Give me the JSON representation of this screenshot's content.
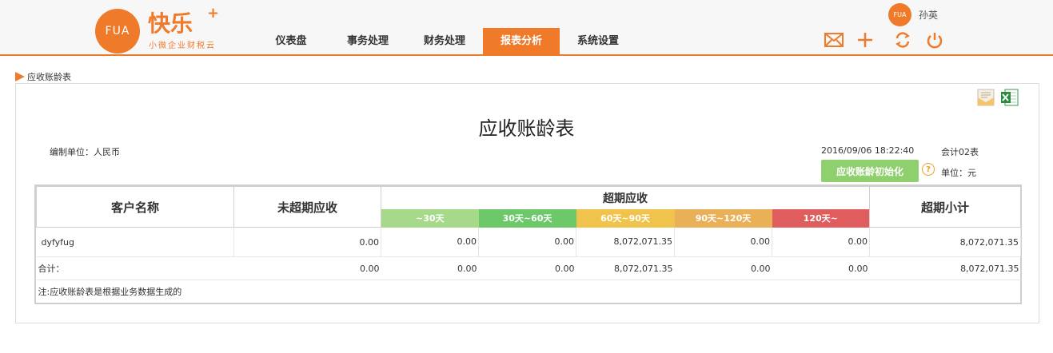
{
  "header": {
    "logo_mark": "FUA",
    "logo_name": "快乐",
    "logo_plus": "+",
    "logo_tagline": "小微企业财税云",
    "nav": [
      {
        "label": "仪表盘",
        "active": false
      },
      {
        "label": "事务处理",
        "active": false
      },
      {
        "label": "财务处理",
        "active": false
      },
      {
        "label": "报表分析",
        "active": true
      },
      {
        "label": "系统设置",
        "active": false
      }
    ],
    "user": {
      "avatar_text": "FUA",
      "name": "孙英"
    },
    "tools": [
      "mail-icon",
      "plus-icon",
      "refresh-icon",
      "power-icon"
    ],
    "accent": "#ef7a2a"
  },
  "breadcrumb": {
    "label": "应收账龄表"
  },
  "report": {
    "title": "应收账龄表",
    "unit_label": "编制单位：人民币",
    "datetime": "2016/09/06 18:22:40",
    "ledger": "会计02表",
    "init_button": "应收账龄初始化",
    "money_unit": "单位：元",
    "export_icons": [
      "email-icon",
      "excel-icon"
    ]
  },
  "table": {
    "headers": {
      "customer": "客户名称",
      "not_overdue": "未超期应收",
      "overdue": "超期应收",
      "subtotal": "超期小计"
    },
    "buckets": [
      {
        "label": "~30天",
        "color": "#a6d98a"
      },
      {
        "label": "30天~60天",
        "color": "#6dc86a"
      },
      {
        "label": "60天~90天",
        "color": "#f0c44c"
      },
      {
        "label": "90天~120天",
        "color": "#eab058"
      },
      {
        "label": "120天~",
        "color": "#e05d5d"
      }
    ],
    "rows": [
      {
        "customer": "dyfyfug",
        "not_overdue": "0.00",
        "buckets": [
          "0.00",
          "0.00",
          "8,072,071.35",
          "0.00",
          "0.00"
        ],
        "subtotal": "8,072,071.35"
      }
    ],
    "total": {
      "label": "合计：",
      "not_overdue": "0.00",
      "buckets": [
        "0.00",
        "0.00",
        "8,072,071.35",
        "0.00",
        "0.00"
      ],
      "subtotal": "8,072,071.35"
    },
    "note": "注:应收账龄表是根据业务数据生成的"
  }
}
